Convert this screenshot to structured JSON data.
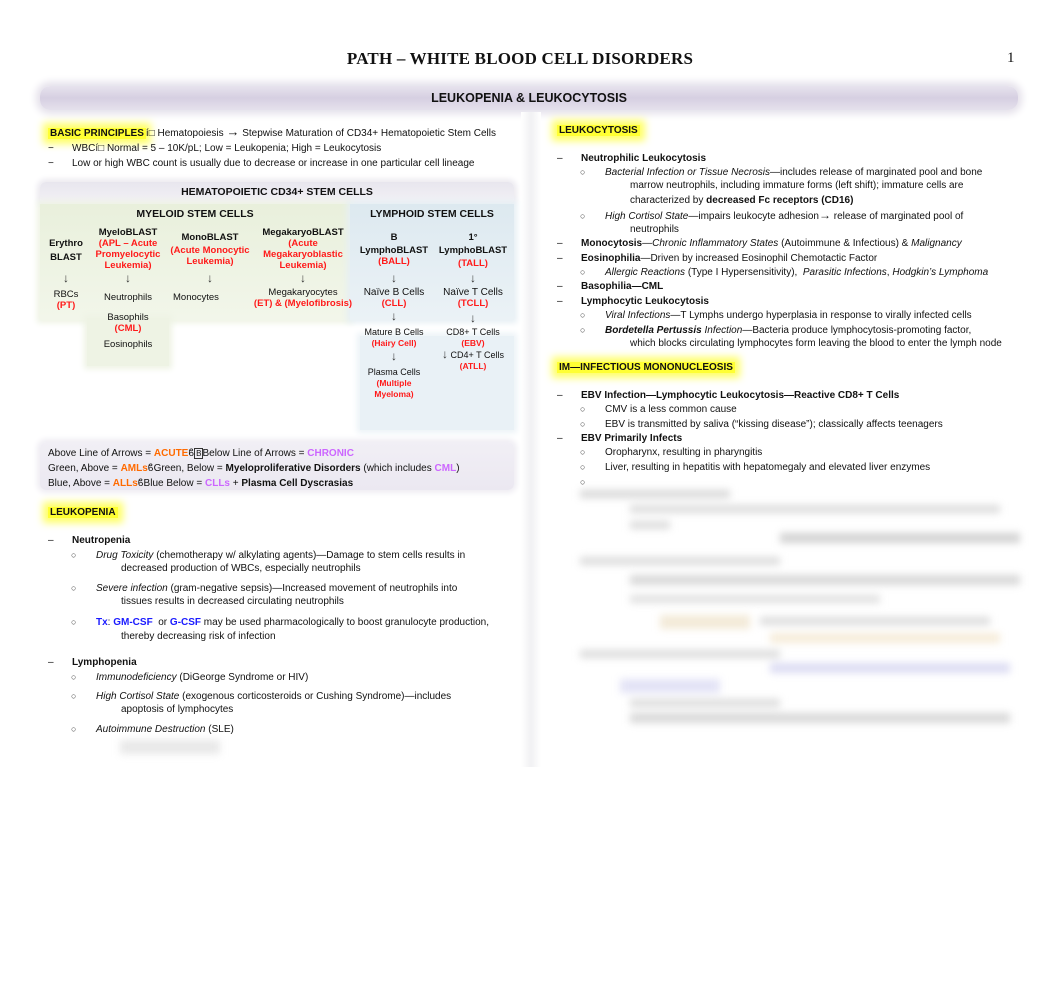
{
  "header": {
    "title": "PATH – WHITE BLOOD CELL DISORDERS",
    "page_number": "1",
    "section_banner": "LEUKOPENIA & LEUKOCYTOSIS"
  },
  "basic_principles": {
    "label": "BASIC PRINCIPLES",
    "sep_glyph": "í",
    "text": "Hematopoiesis",
    "arrow": "→",
    "text2": "Stepwise Maturation of CD34+ Hematopoietic Stem Cells",
    "items": [
      {
        "prefix": "WBCí",
        "text": "Normal = 5 – 10K/pL; Low = Leukopenia; High = Leukocytosis"
      },
      {
        "text": "Low or high WBC count is usually due to decrease or increase in one particular cell lineage"
      }
    ]
  },
  "hematopoiesis_chart": {
    "title": "HEMATOPOIETIC CD34+ STEM CELLS",
    "myeloid_title": "MYELOID STEM CELLS",
    "lymphoid_title": "LYMPHOID STEM CELLS",
    "arrow": "↓",
    "columns": [
      {
        "blast": [
          "Erythro",
          "BLAST"
        ],
        "blast_disease": "",
        "products": [
          {
            "name": "RBCs",
            "disease": "(PT)"
          }
        ]
      },
      {
        "blast": [
          "MyeloBLAST"
        ],
        "blast_disease": [
          "(APL – Acute",
          "Promyelocytic",
          "Leukemia)"
        ],
        "products": [
          {
            "name": "Neutrophils",
            "disease": ""
          },
          {
            "name": "Basophils",
            "disease": "(CML)"
          },
          {
            "name": "Eosinophils",
            "disease": ""
          }
        ]
      },
      {
        "blast": [
          "MonoBLAST"
        ],
        "blast_disease": [
          "(Acute Monocytic",
          "Leukemia)"
        ],
        "products": [
          {
            "name": "Monocytes",
            "disease": ""
          }
        ]
      },
      {
        "blast": [
          "MegakaryoBLAST"
        ],
        "blast_disease": [
          "(Acute",
          "Megakaryoblastic",
          "Leukemia)"
        ],
        "products": [
          {
            "name": "Megakaryocytes",
            "disease": "(ET) & (Myelofibrosis)"
          }
        ]
      },
      {
        "blast": [
          "B",
          "LymphoBLAST"
        ],
        "blast_disease": [
          "(BALL)"
        ],
        "products": [
          {
            "name": "Naïve B Cells",
            "disease": "(CLL)"
          },
          {
            "name": "Mature B Cells",
            "disease": "(Hairy Cell)"
          },
          {
            "name": "Plasma Cells",
            "disease": "(Multiple Myeloma)",
            "disease_lines": [
              "(Multiple",
              "Myeloma)"
            ]
          }
        ]
      },
      {
        "blast": [
          "1°",
          "LymphoBLAST"
        ],
        "blast_disease": [
          "(TALL)"
        ],
        "products": [
          {
            "name": "Naïve T Cells",
            "disease": "(TCLL)"
          },
          {
            "name": "CD8+ T Cells",
            "disease": "(EBV)"
          },
          {
            "name": "CD4+ T Cells",
            "disease": "(ATLL)"
          }
        ]
      }
    ]
  },
  "legend": {
    "line1": {
      "a": "Above Line of Arrows = ",
      "acute": "ACUTE",
      "sep": "ϐ",
      "b": "Below Line of Arrows = ",
      "chronic": "CHRONIC"
    },
    "line2": {
      "a": "Green, Above = ",
      "amls": "AMLs",
      "sep": "ϐ",
      "b": "Green, Below = ",
      "mpd": "Myeloproliferative Disorders",
      "c": " (which includes ",
      "cml": "CML",
      "d": ")"
    },
    "line3": {
      "a": "Blue, Above = ",
      "alls": "ALLs",
      "sep": "ϐ",
      "b": "Blue Below = ",
      "clls": "CLLs",
      "c": " + ",
      "pcd": "Plasma Cell Dyscrasias"
    }
  },
  "leukopenia": {
    "heading": "LEUKOPENIA",
    "dash": "–",
    "bullet": "○",
    "groups": [
      {
        "title": "Neutropenia",
        "items": [
          {
            "em": "Drug Toxicity",
            "text": " (chemotherapy w/ alkylating agents)—Damage to stem cells results in",
            "cont": "decreased production of WBCs, especially neutrophils"
          },
          {
            "em": "Severe infection",
            "text": " (gram-negative sepsis)—Increased movement of neutrophils into",
            "cont": "tissues results in decreased circulating neutrophils"
          },
          {
            "tx": "Tx",
            "colon": ": ",
            "drug1": "GM-CSF",
            "or": "  or ",
            "drug2": "G-CSF",
            "text": " may be used pharmacologically to boost granulocyte production,",
            "cont": "thereby decreasing risk of infection"
          }
        ]
      },
      {
        "title": "Lymphopenia",
        "items": [
          {
            "em": "Immunodeficiency",
            "text": " (DiGeorge Syndrome or HIV)"
          },
          {
            "em": "High Cortisol State",
            "text": " (exogenous corticosteroids or Cushing Syndrome)—includes",
            "cont": "apoptosis of lymphocytes"
          },
          {
            "em": "Autoimmune Destruction",
            "text": " (SLE)"
          }
        ]
      }
    ]
  },
  "leukocytosis": {
    "heading": "LEUKOCYTOSIS",
    "neutrophilic": {
      "title": "Neutrophilic Leukocytosis",
      "items": [
        {
          "em": "Bacterial Infection or Tissue Necrosis",
          "text": "—includes release of marginated pool and bone",
          "cont1": "marrow neutrophils, including immature forms (left shift); immature cells are",
          "cont2a": "characterized by ",
          "cont2b": "decreased Fc receptors (CD16)"
        },
        {
          "em": "High Cortisol State",
          "text": "—impairs leukocyte adhesion",
          "arrow": "→",
          "text2": " release of marginated pool of",
          "cont": "neutrophils"
        }
      ]
    },
    "monocytosis": {
      "title": "Monocytosis",
      "dash": "—",
      "em1": "Chronic Inflammatory States",
      "text": " (Autoimmune & Infectious) & ",
      "em2": "Malignancy"
    },
    "eosinophilia": {
      "title": "Eosinophilia",
      "text": "—Driven by increased Eosinophil Chemotactic Factor",
      "item": {
        "em1": "Allergic Reactions",
        "t1": " (Type I Hypersensitivity),  ",
        "em2": "Parasitic Infections",
        "t2": ", ",
        "em3": "Hodgkin’s Lymphoma"
      }
    },
    "basophilia": {
      "title": "Basophilia—CML"
    },
    "lymphocytic": {
      "title": "Lymphocytic Leukocytosis",
      "items": [
        {
          "em": "Viral Infections",
          "text": "—T Lymphs undergo hyperplasia in response to virally infected cells"
        },
        {
          "bem": "Bordetella Pertussis",
          "em": " Infection",
          "text": "—Bacteria produce lymphocytosis-promoting factor,",
          "cont": "which blocks circulating lymphocytes form leaving the blood to enter the lymph node"
        }
      ]
    }
  },
  "mono": {
    "heading": "IM—INFECTIOUS MONONUCLEOSIS",
    "groups": [
      {
        "title": "EBV Infection—Lymphocytic Leukocytosis—Reactive CD8+ T Cells",
        "items": [
          "CMV is a less common cause",
          "EBV is transmitted by saliva (“kissing disease”); classically affects teenagers"
        ]
      },
      {
        "title": "EBV Primarily Infects",
        "items": [
          "Oropharynx, resulting in pharyngitis",
          "Liver, resulting in hepatitis with hepatomegaly and elevated liver enzymes",
          ""
        ]
      }
    ]
  }
}
